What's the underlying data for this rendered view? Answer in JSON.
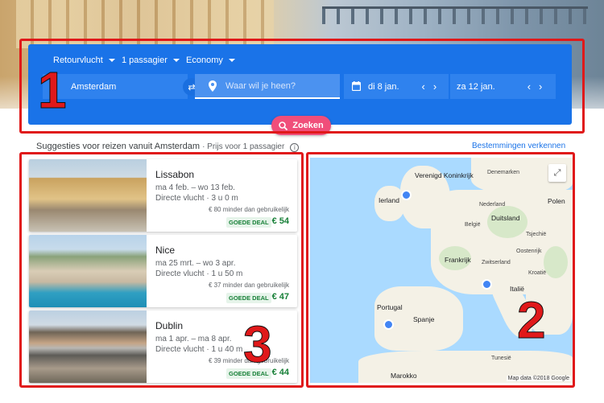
{
  "search": {
    "trip_type": "Retourvlucht",
    "passengers": "1 passagier",
    "cabin": "Economy",
    "origin": "Amsterdam",
    "destination_placeholder": "Waar wil je heen?",
    "depart_date": "di 8 jan.",
    "return_date": "za 12 jan.",
    "search_label": "Zoeken"
  },
  "suggestions": {
    "title": "Suggesties voor reizen vanuit Amsterdam",
    "price_note": "· Prijs voor 1 passagier",
    "explore_link": "Bestemmingen verkennen"
  },
  "cards": [
    {
      "city": "Lissabon",
      "dates": "ma 4 feb. – wo 13 feb.",
      "flight": "Directe vlucht · 3 u 0 m",
      "saving": "€ 80 minder dan gebruikelijk",
      "badge": "GOEDE DEAL",
      "price": "€ 54"
    },
    {
      "city": "Nice",
      "dates": "ma 25 mrt. – wo 3 apr.",
      "flight": "Directe vlucht · 1 u 50 m",
      "saving": "€ 37 minder dan gebruikelijk",
      "badge": "GOEDE DEAL",
      "price": "€ 47"
    },
    {
      "city": "Dublin",
      "dates": "ma 1 apr. – ma 8 apr.",
      "flight": "Directe vlucht · 1 u 40 m",
      "saving": "€ 39 minder dan gebruikelijk",
      "badge": "GOEDE DEAL",
      "price": "€ 44"
    }
  ],
  "map": {
    "labels": {
      "uk": "Verenigd Koninkrijk",
      "ierland": "Ierland",
      "denemarken": "Denemarken",
      "nederland": "Nederland",
      "belgie": "België",
      "duitsland": "Duitsland",
      "polen": "Polen",
      "tsjechie": "Tsjechië",
      "frankrijk": "Frankrijk",
      "oostenrijk": "Oostenrijk",
      "zwitserland": "Zwitserland",
      "kroatie": "Kroatië",
      "italie": "Italië",
      "portugal": "Portugal",
      "spanje": "Spanje",
      "tunesie": "Tunesië",
      "marokko": "Marokko"
    },
    "attribution": "Map data ©2018 Google"
  },
  "annotations": {
    "one": "1",
    "two": "2",
    "three": "3"
  },
  "colors": {
    "panel": "#1a73e8",
    "search_button": "#f04e7a",
    "deal_green": "#188038",
    "annotation_red": "#e0191a"
  },
  "icons": {
    "location": "location-pin-icon",
    "calendar": "calendar-icon",
    "search": "search-icon",
    "swap": "swap-icon",
    "expand": "expand-icon",
    "info": "info-icon"
  }
}
